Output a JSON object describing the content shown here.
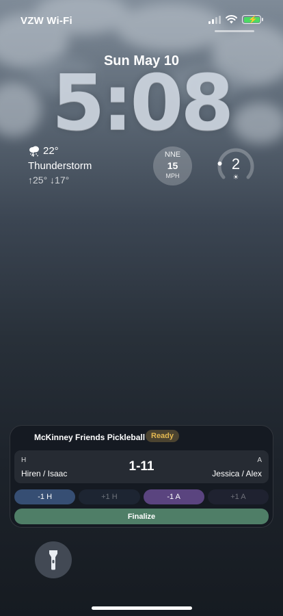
{
  "status": {
    "carrier": "VZW Wi-Fi"
  },
  "lockscreen": {
    "date": "Sun May 10",
    "time": "5:08"
  },
  "weather": {
    "temp": "22°",
    "condition": "Thunderstorm",
    "hilo": "↑25° ↓17°",
    "icon": "thunderstorm-icon"
  },
  "wind": {
    "direction": "NNE",
    "speed": "15",
    "unit": "MPH"
  },
  "uv": {
    "value": "2",
    "icon": "sun-icon",
    "level": 0.2
  },
  "widget": {
    "title": "McKinney Friends Pickleball",
    "status_badge": "Ready",
    "home_label": "H",
    "away_label": "A",
    "home_team": "Hiren / Isaac",
    "away_team": "Jessica / Alex",
    "score": "1-11",
    "buttons": {
      "home_minus": "-1 H",
      "home_plus": "+1 H",
      "away_minus": "-1 A",
      "away_plus": "+1 A",
      "finalize": "Finalize"
    }
  },
  "colors": {
    "badge": "#e3b851",
    "finalize": "#4f7e67",
    "home": "#364e73",
    "away": "#5a447f"
  }
}
